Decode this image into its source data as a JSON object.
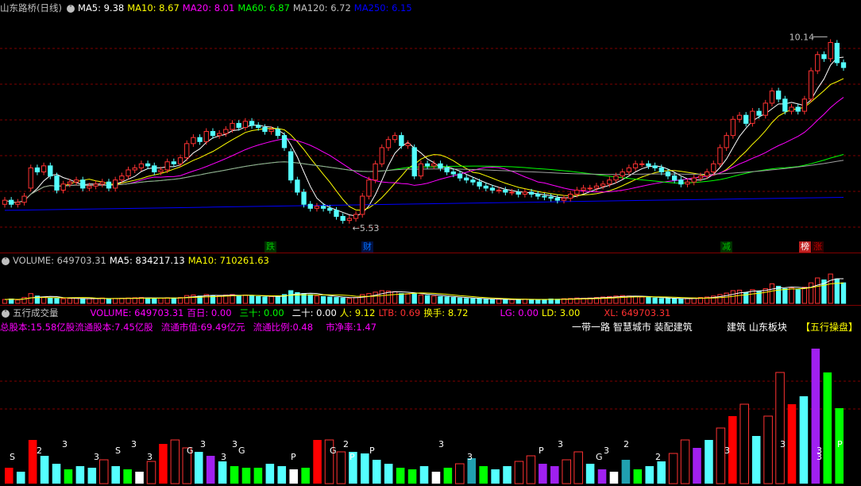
{
  "price_header": {
    "title": "山东路桥(日线)",
    "ma5": "MA5: 9.38",
    "ma10": "MA10: 8.67",
    "ma20": "MA20: 8.01",
    "ma60": "MA60: 6.87",
    "ma120": "MA120: 6.72",
    "ma250": "MA250: 6.15"
  },
  "price_annotations": {
    "high": "10.14",
    "low": "5.53"
  },
  "event_tags": [
    {
      "label": "跌",
      "color": "#00c000"
    },
    {
      "label": "财",
      "color": "#0070ff"
    },
    {
      "label": "减",
      "color": "#00c000"
    },
    {
      "label": "榜",
      "color": "#c00000"
    },
    {
      "label": "涨",
      "color": "#c00000"
    }
  ],
  "volume_header": {
    "title": "VOLUME: 649703.31",
    "ma5": "MA5: 834217.13",
    "ma10": "MA10: 710261.63"
  },
  "wuxing_header": {
    "title": "五行成交量",
    "volume": "VOLUME: 649703.31",
    "bairi": "百日: 0.00",
    "sanshi": "三十: 0.00",
    "ershi": "二十: 0.00",
    "ren": "人: 9.12",
    "ltb": "LTB: 0.69",
    "huanshou": "换手: 8.72",
    "lg": "LG: 0.00",
    "ld": "LD: 3.00",
    "xl": "XL: 649703.31"
  },
  "info": {
    "total_shares": "总股本:15.58亿股",
    "float_shares": "流通股本:7.45亿股",
    "float_value": "流通市值:69.49亿元",
    "float_ratio": "流通比例:0.48",
    "pb": "市净率:1.47",
    "concepts": "一带一路 智慧城市 装配建筑",
    "industry": "建筑  山东板块",
    "panel": "【五行操盘】"
  },
  "colors": {
    "up": "#ff3232",
    "down": "#54ffff",
    "ma5": "#ffffff",
    "ma10": "#ffff00",
    "ma20": "#ff00ff",
    "ma60": "#00ff00",
    "ma120": "#a0a0a0",
    "ma250": "#0000ff",
    "grid": "#800000",
    "wx_red": "#ff0000",
    "wx_cyan": "#54ffff",
    "wx_green": "#00ff00",
    "wx_purple": "#a020f0",
    "wx_white": "#ffffff",
    "wx_teal": "#20a0b0",
    "wx_hollow": "#ff3232"
  },
  "chart_data": {
    "type": "candlestick",
    "close": [
      6.1,
      6.0,
      6.05,
      6.2,
      6.9,
      6.8,
      6.95,
      6.7,
      6.35,
      6.5,
      6.55,
      6.6,
      6.4,
      6.45,
      6.5,
      6.55,
      6.4,
      6.6,
      6.7,
      6.85,
      6.9,
      7.0,
      6.95,
      6.8,
      6.85,
      7.05,
      7.0,
      7.15,
      7.5,
      7.65,
      7.55,
      7.8,
      7.7,
      7.75,
      7.85,
      8.0,
      7.9,
      8.05,
      7.95,
      7.9,
      7.8,
      7.85,
      7.7,
      7.4,
      6.6,
      6.3,
      6.0,
      5.9,
      5.95,
      5.9,
      5.85,
      5.7,
      5.6,
      5.65,
      5.75,
      6.2,
      6.6,
      7.0,
      7.4,
      7.6,
      7.7,
      7.45,
      7.5,
      6.7,
      7.0,
      6.95,
      7.0,
      6.9,
      6.8,
      6.75,
      6.65,
      6.6,
      6.55,
      6.45,
      6.4,
      6.35,
      6.35,
      6.3,
      6.3,
      6.25,
      6.3,
      6.25,
      6.2,
      6.18,
      6.15,
      6.1,
      6.15,
      6.25,
      6.35,
      6.4,
      6.4,
      6.45,
      6.5,
      6.6,
      6.7,
      6.8,
      6.9,
      7.0,
      7.0,
      6.95,
      6.9,
      6.8,
      6.7,
      6.6,
      6.5,
      6.55,
      6.65,
      6.7,
      6.8,
      7.0,
      7.4,
      7.7,
      8.1,
      8.2,
      8.0,
      8.3,
      8.2,
      8.5,
      8.8,
      8.6,
      8.3,
      8.4,
      8.3,
      8.6,
      9.3,
      9.7,
      9.6,
      10.0,
      9.5,
      9.38
    ],
    "open": [
      6.0,
      6.1,
      6.0,
      6.05,
      6.4,
      6.9,
      6.8,
      6.95,
      6.7,
      6.35,
      6.5,
      6.55,
      6.6,
      6.4,
      6.45,
      6.5,
      6.55,
      6.4,
      6.6,
      6.7,
      6.85,
      6.9,
      7.0,
      6.95,
      6.8,
      6.85,
      7.05,
      7.0,
      7.15,
      7.5,
      7.65,
      7.55,
      7.8,
      7.7,
      7.75,
      7.85,
      8.0,
      7.9,
      8.05,
      7.95,
      7.9,
      7.8,
      7.85,
      7.7,
      7.3,
      6.6,
      6.3,
      6.0,
      5.9,
      5.95,
      5.9,
      5.85,
      5.7,
      5.6,
      5.65,
      5.75,
      6.2,
      6.6,
      7.0,
      7.4,
      7.6,
      7.7,
      7.45,
      7.4,
      6.7,
      7.0,
      6.95,
      7.0,
      6.9,
      6.8,
      6.75,
      6.65,
      6.6,
      6.55,
      6.45,
      6.4,
      6.35,
      6.35,
      6.3,
      6.3,
      6.25,
      6.3,
      6.25,
      6.2,
      6.18,
      6.15,
      6.1,
      6.15,
      6.25,
      6.35,
      6.4,
      6.4,
      6.45,
      6.5,
      6.6,
      6.7,
      6.8,
      6.9,
      7.0,
      7.0,
      6.95,
      6.9,
      6.8,
      6.7,
      6.6,
      6.5,
      6.55,
      6.65,
      6.7,
      6.8,
      7.0,
      7.4,
      7.7,
      8.1,
      8.2,
      8.0,
      8.3,
      8.2,
      8.5,
      8.8,
      8.6,
      8.3,
      8.4,
      8.3,
      8.6,
      9.3,
      9.7,
      9.6,
      9.98,
      9.5
    ],
    "ylim": [
      5.2,
      10.5
    ],
    "volume": [
      80,
      90,
      70,
      120,
      200,
      150,
      130,
      110,
      100,
      95,
      100,
      105,
      90,
      95,
      100,
      110,
      95,
      100,
      105,
      110,
      115,
      120,
      110,
      100,
      105,
      115,
      110,
      120,
      160,
      170,
      150,
      180,
      160,
      150,
      170,
      180,
      160,
      170,
      150,
      140,
      130,
      140,
      150,
      180,
      260,
      220,
      200,
      180,
      150,
      140,
      130,
      120,
      110,
      100,
      120,
      180,
      200,
      230,
      260,
      250,
      240,
      200,
      190,
      210,
      170,
      160,
      150,
      140,
      130,
      120,
      110,
      100,
      95,
      90,
      85,
      80,
      85,
      80,
      75,
      80,
      85,
      80,
      75,
      80,
      90,
      85,
      95,
      100,
      110,
      105,
      110,
      120,
      130,
      140,
      150,
      160,
      150,
      140,
      130,
      120,
      110,
      100,
      100,
      95,
      90,
      100,
      110,
      120,
      130,
      150,
      180,
      210,
      260,
      270,
      220,
      280,
      250,
      300,
      400,
      350,
      300,
      320,
      280,
      330,
      420,
      520,
      480,
      600,
      500,
      420
    ],
    "wuxing_bars": [
      {
        "i": 0,
        "v": 20,
        "c": "red"
      },
      {
        "i": 2,
        "v": 15,
        "c": "cyan"
      },
      {
        "i": 4,
        "v": 55,
        "c": "red"
      },
      {
        "i": 6,
        "v": 35,
        "c": "cyan"
      },
      {
        "i": 8,
        "v": 25,
        "c": "cyan"
      },
      {
        "i": 10,
        "v": 18,
        "c": "green"
      },
      {
        "i": 12,
        "v": 22,
        "c": "cyan"
      },
      {
        "i": 14,
        "v": 20,
        "c": "cyan"
      },
      {
        "i": 16,
        "v": 30,
        "c": "hollow"
      },
      {
        "i": 18,
        "v": 22,
        "c": "cyan"
      },
      {
        "i": 20,
        "v": 18,
        "c": "green"
      },
      {
        "i": 22,
        "v": 15,
        "c": "white"
      },
      {
        "i": 24,
        "v": 28,
        "c": "hollow"
      },
      {
        "i": 26,
        "v": 50,
        "c": "red"
      },
      {
        "i": 28,
        "v": 55,
        "c": "hollow"
      },
      {
        "i": 30,
        "v": 45,
        "c": "hollow"
      },
      {
        "i": 32,
        "v": 40,
        "c": "cyan"
      },
      {
        "i": 34,
        "v": 35,
        "c": "purple"
      },
      {
        "i": 36,
        "v": 28,
        "c": "cyan"
      },
      {
        "i": 38,
        "v": 22,
        "c": "green"
      },
      {
        "i": 40,
        "v": 20,
        "c": "green"
      },
      {
        "i": 42,
        "v": 20,
        "c": "green"
      },
      {
        "i": 44,
        "v": 25,
        "c": "cyan"
      },
      {
        "i": 46,
        "v": 22,
        "c": "cyan"
      },
      {
        "i": 48,
        "v": 18,
        "c": "white"
      },
      {
        "i": 50,
        "v": 20,
        "c": "green"
      },
      {
        "i": 52,
        "v": 55,
        "c": "red"
      },
      {
        "i": 54,
        "v": 55,
        "c": "hollow"
      },
      {
        "i": 56,
        "v": 40,
        "c": "hollow"
      },
      {
        "i": 58,
        "v": 40,
        "c": "cyan"
      },
      {
        "i": 60,
        "v": 38,
        "c": "cyan"
      },
      {
        "i": 62,
        "v": 30,
        "c": "cyan"
      },
      {
        "i": 64,
        "v": 25,
        "c": "cyan"
      },
      {
        "i": 66,
        "v": 20,
        "c": "green"
      },
      {
        "i": 68,
        "v": 18,
        "c": "green"
      },
      {
        "i": 70,
        "v": 22,
        "c": "cyan"
      },
      {
        "i": 72,
        "v": 15,
        "c": "white"
      },
      {
        "i": 74,
        "v": 20,
        "c": "green"
      },
      {
        "i": 76,
        "v": 25,
        "c": "hollow"
      },
      {
        "i": 78,
        "v": 32,
        "c": "teal"
      },
      {
        "i": 80,
        "v": 22,
        "c": "green"
      },
      {
        "i": 82,
        "v": 18,
        "c": "cyan"
      },
      {
        "i": 84,
        "v": 22,
        "c": "cyan"
      },
      {
        "i": 86,
        "v": 28,
        "c": "hollow"
      },
      {
        "i": 88,
        "v": 35,
        "c": "hollow"
      },
      {
        "i": 90,
        "v": 25,
        "c": "purple"
      },
      {
        "i": 92,
        "v": 22,
        "c": "purple"
      },
      {
        "i": 94,
        "v": 30,
        "c": "hollow"
      },
      {
        "i": 96,
        "v": 40,
        "c": "hollow"
      },
      {
        "i": 98,
        "v": 25,
        "c": "cyan"
      },
      {
        "i": 100,
        "v": 18,
        "c": "purple"
      },
      {
        "i": 102,
        "v": 15,
        "c": "white"
      },
      {
        "i": 104,
        "v": 30,
        "c": "teal"
      },
      {
        "i": 106,
        "v": 18,
        "c": "green"
      },
      {
        "i": 108,
        "v": 22,
        "c": "cyan"
      },
      {
        "i": 110,
        "v": 28,
        "c": "cyan"
      },
      {
        "i": 112,
        "v": 38,
        "c": "hollow"
      },
      {
        "i": 114,
        "v": 55,
        "c": "hollow"
      },
      {
        "i": 116,
        "v": 45,
        "c": "purple"
      },
      {
        "i": 118,
        "v": 55,
        "c": "cyan"
      },
      {
        "i": 120,
        "v": 70,
        "c": "hollow"
      },
      {
        "i": 122,
        "v": 85,
        "c": "red"
      },
      {
        "i": 124,
        "v": 100,
        "c": "hollow"
      },
      {
        "i": 126,
        "v": 60,
        "c": "cyan"
      },
      {
        "i": 128,
        "v": 85,
        "c": "hollow"
      },
      {
        "i": 130,
        "v": 140,
        "c": "hollow"
      },
      {
        "i": 132,
        "v": 100,
        "c": "red"
      },
      {
        "i": 134,
        "v": 110,
        "c": "cyan"
      },
      {
        "i": 136,
        "v": 170,
        "c": "purple"
      },
      {
        "i": 138,
        "v": 140,
        "c": "green"
      },
      {
        "i": 140,
        "v": 95,
        "c": "green"
      }
    ],
    "wuxing_labels": [
      "S",
      "2",
      "3",
      "3",
      "S",
      "3",
      "3",
      "G",
      "3",
      "3",
      "G",
      "3",
      "P",
      "G",
      "2",
      "P",
      "P",
      "3",
      "3",
      "P",
      "3",
      "G",
      "3",
      "2",
      "2",
      "3",
      "3",
      "3",
      "3",
      "P"
    ],
    "xlabel": "",
    "ylabel": ""
  }
}
